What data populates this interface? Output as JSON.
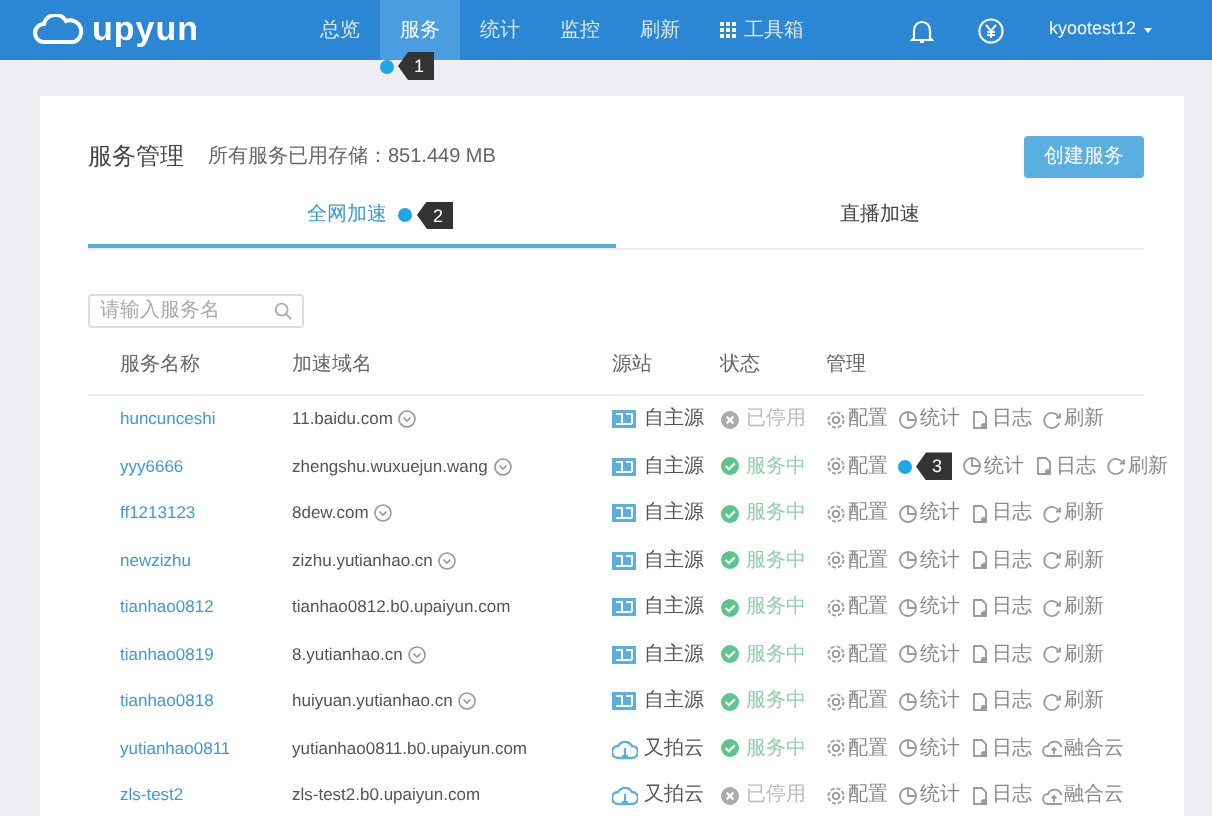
{
  "brand": "upyun",
  "nav": [
    {
      "label": "总览",
      "selected": false
    },
    {
      "label": "服务",
      "selected": true
    },
    {
      "label": "统计",
      "selected": false
    },
    {
      "label": "监控",
      "selected": false
    },
    {
      "label": "刷新",
      "selected": false
    },
    {
      "label": "工具箱",
      "selected": false,
      "kind": "grid"
    }
  ],
  "user": "kyootest12",
  "callouts": [
    "1",
    "2",
    "3"
  ],
  "page_title": "服务管理",
  "storage_note": "所有服务已用存储：851.449 MB",
  "create_button": "创建服务",
  "tabs": [
    {
      "label": "全网加速",
      "selected": true
    },
    {
      "label": "直播加速",
      "selected": false
    }
  ],
  "search": {
    "placeholder": "请输入服务名"
  },
  "columns": [
    "服务名称",
    "加速域名",
    "源站",
    "状态",
    "管理"
  ],
  "rows": [
    {
      "name": "huncunceshi",
      "domain": "11.baidu.com",
      "dropdown": true,
      "source": {
        "kind": "self",
        "label": "自主源"
      },
      "status": {
        "kind": "stopped",
        "label": "已停用"
      },
      "actions": [
        {
          "kind": "config",
          "label": "配置"
        },
        {
          "kind": "stats",
          "label": "统计"
        },
        {
          "kind": "log",
          "label": "日志"
        },
        {
          "kind": "refresh",
          "label": "刷新"
        }
      ]
    },
    {
      "name": "yyy6666",
      "domain": "zhengshu.wuxuejun.wang",
      "dropdown": true,
      "source": {
        "kind": "self",
        "label": "自主源"
      },
      "status": {
        "kind": "running",
        "label": "服务中"
      },
      "actions": [
        {
          "kind": "config",
          "label": "配置"
        },
        {
          "kind": "stats",
          "label": "统计"
        },
        {
          "kind": "log",
          "label": "日志"
        },
        {
          "kind": "refresh",
          "label": "刷新"
        }
      ]
    },
    {
      "name": "ff1213123",
      "domain": "8dew.com",
      "dropdown": true,
      "source": {
        "kind": "self",
        "label": "自主源"
      },
      "status": {
        "kind": "running",
        "label": "服务中"
      },
      "actions": [
        {
          "kind": "config",
          "label": "配置"
        },
        {
          "kind": "stats",
          "label": "统计"
        },
        {
          "kind": "log",
          "label": "日志"
        },
        {
          "kind": "refresh",
          "label": "刷新"
        }
      ]
    },
    {
      "name": "newzizhu",
      "domain": "zizhu.yutianhao.cn",
      "dropdown": true,
      "source": {
        "kind": "self",
        "label": "自主源"
      },
      "status": {
        "kind": "running",
        "label": "服务中"
      },
      "actions": [
        {
          "kind": "config",
          "label": "配置"
        },
        {
          "kind": "stats",
          "label": "统计"
        },
        {
          "kind": "log",
          "label": "日志"
        },
        {
          "kind": "refresh",
          "label": "刷新"
        }
      ]
    },
    {
      "name": "tianhao0812",
      "domain": "tianhao0812.b0.upaiyun.com",
      "dropdown": false,
      "source": {
        "kind": "self",
        "label": "自主源"
      },
      "status": {
        "kind": "running",
        "label": "服务中"
      },
      "actions": [
        {
          "kind": "config",
          "label": "配置"
        },
        {
          "kind": "stats",
          "label": "统计"
        },
        {
          "kind": "log",
          "label": "日志"
        },
        {
          "kind": "refresh",
          "label": "刷新"
        }
      ]
    },
    {
      "name": "tianhao0819",
      "domain": "8.yutianhao.cn",
      "dropdown": true,
      "source": {
        "kind": "self",
        "label": "自主源"
      },
      "status": {
        "kind": "running",
        "label": "服务中"
      },
      "actions": [
        {
          "kind": "config",
          "label": "配置"
        },
        {
          "kind": "stats",
          "label": "统计"
        },
        {
          "kind": "log",
          "label": "日志"
        },
        {
          "kind": "refresh",
          "label": "刷新"
        }
      ]
    },
    {
      "name": "tianhao0818",
      "domain": "huiyuan.yutianhao.cn",
      "dropdown": true,
      "source": {
        "kind": "self",
        "label": "自主源"
      },
      "status": {
        "kind": "running",
        "label": "服务中"
      },
      "actions": [
        {
          "kind": "config",
          "label": "配置"
        },
        {
          "kind": "stats",
          "label": "统计"
        },
        {
          "kind": "log",
          "label": "日志"
        },
        {
          "kind": "refresh",
          "label": "刷新"
        }
      ]
    },
    {
      "name": "yutianhao0811",
      "domain": "yutianhao0811.b0.upaiyun.com",
      "dropdown": false,
      "source": {
        "kind": "upyun",
        "label": "又拍云"
      },
      "status": {
        "kind": "running",
        "label": "服务中"
      },
      "actions": [
        {
          "kind": "config",
          "label": "配置"
        },
        {
          "kind": "stats",
          "label": "统计"
        },
        {
          "kind": "log",
          "label": "日志"
        },
        {
          "kind": "fusion",
          "label": "融合云"
        }
      ]
    },
    {
      "name": "zls-test2",
      "domain": "zls-test2.b0.upaiyun.com",
      "dropdown": false,
      "source": {
        "kind": "upyun",
        "label": "又拍云"
      },
      "status": {
        "kind": "stopped",
        "label": "已停用"
      },
      "actions": [
        {
          "kind": "config",
          "label": "配置"
        },
        {
          "kind": "stats",
          "label": "统计"
        },
        {
          "kind": "log",
          "label": "日志"
        },
        {
          "kind": "fusion",
          "label": "融合云"
        }
      ]
    }
  ]
}
